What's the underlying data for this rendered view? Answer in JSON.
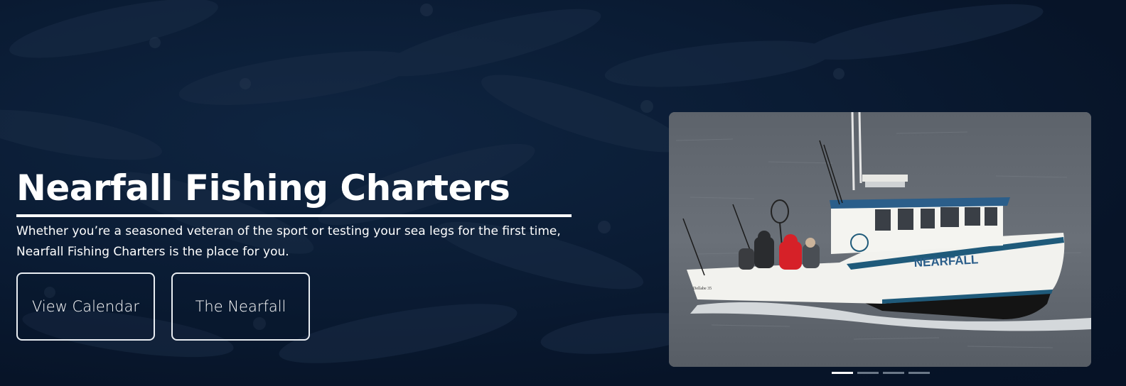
{
  "hero": {
    "title": "Nearfall Fishing Charters",
    "description_line1": "Whether you’re a seasoned veteran of the sport or testing your sea legs for the first time,",
    "description_line2": "Nearfall Fishing Charters is the place for you.",
    "buttons": [
      {
        "label": "View Calendar"
      },
      {
        "label": "The Nearfall"
      }
    ]
  },
  "slider": {
    "boat_name": "NEARFALL",
    "hull_mark": "Dellabe 35",
    "slide_count": 4,
    "active_slide": 1
  },
  "colors": {
    "background": "#0a1b33",
    "text": "#ffffff",
    "button_border": "#e9edf2",
    "boat_hull": "#f2f2ee",
    "boat_stripe": "#1f5a7a",
    "boat_lettering": "#2b5e8a",
    "jacket_red": "#d62128",
    "sea": "#646a71"
  }
}
